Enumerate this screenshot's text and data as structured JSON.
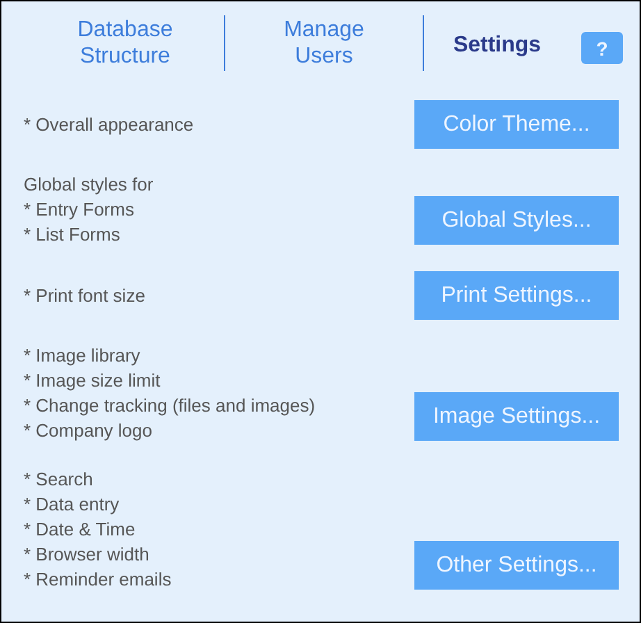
{
  "tabs": [
    {
      "label": "Database Structure",
      "selected": false
    },
    {
      "label": "Manage Users",
      "selected": false
    },
    {
      "label": "Settings",
      "selected": true
    }
  ],
  "help_button": "?",
  "sections": [
    {
      "lines": [
        "* Overall appearance"
      ],
      "button": "Color Theme..."
    },
    {
      "lines": [
        "Global styles for",
        "* Entry Forms",
        "* List Forms"
      ],
      "button": "Global Styles..."
    },
    {
      "lines": [
        "* Print font size"
      ],
      "button": "Print Settings..."
    },
    {
      "lines": [
        "* Image library",
        "* Image size limit",
        "* Change tracking (files and images)",
        "* Company logo"
      ],
      "button": "Image Settings..."
    },
    {
      "lines": [
        "* Search",
        "* Data entry",
        "* Date & Time",
        "* Browser width",
        "* Reminder emails"
      ],
      "button": "Other Settings..."
    }
  ]
}
